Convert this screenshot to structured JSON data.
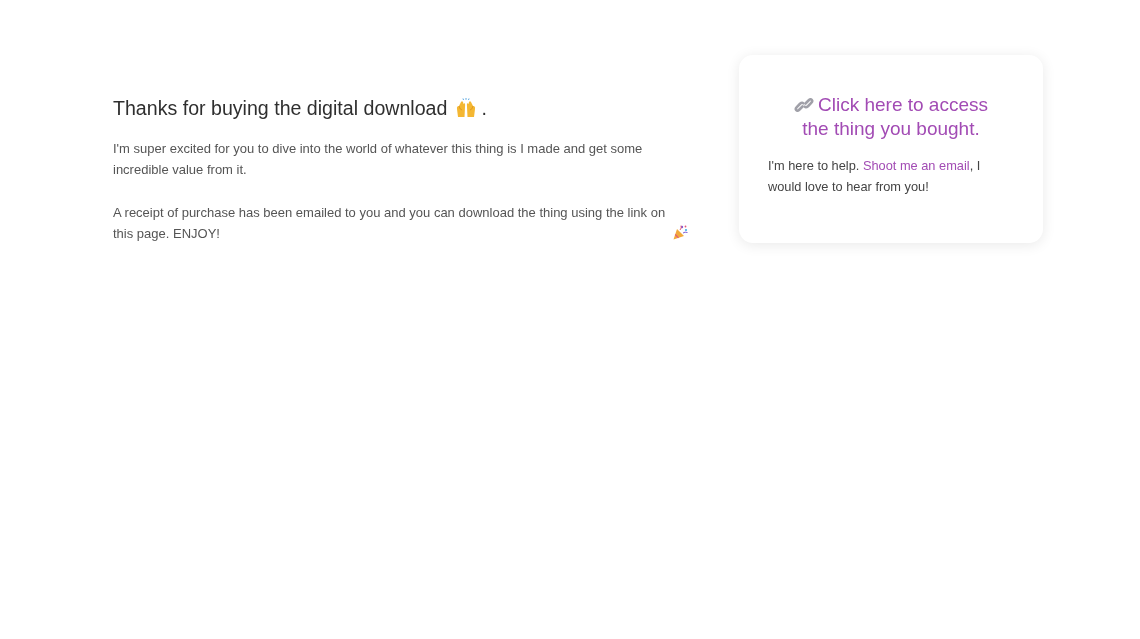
{
  "intro": {
    "heading": "Thanks for buying the digital download",
    "heading_end": ".",
    "paragraphs": [
      "I'm super excited for you to dive into the world of whatever this thing is I made and get some incredible value from it.",
      "A receipt of purchase has been emailed to you and you can download the thing using the link on this page. ENJOY!"
    ]
  },
  "access_card": {
    "link": "Click here to access the thing you bought.",
    "help": {
      "before": "I'm here to help.",
      "link": "Shoot me an email",
      "after": ", I would love to hear from you!"
    }
  }
}
